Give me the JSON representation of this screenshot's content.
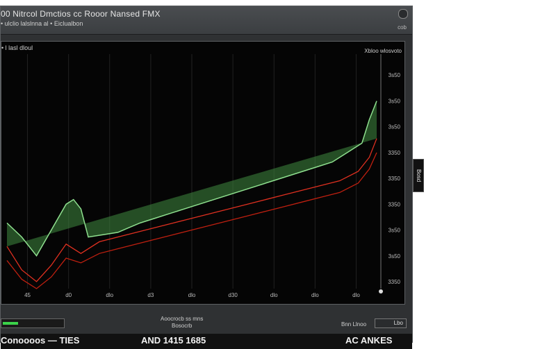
{
  "window": {
    "title": "00 Nitrcol Dmctios cc  Rooor Nansed FMX",
    "subtitle": "• ulclio lalslnna al • Eiclualbon",
    "small_label": "cob"
  },
  "plot": {
    "caption": "• l  lasl dloul",
    "legend": "Xbloo wlosvoto"
  },
  "chart_data": {
    "type": "line",
    "x_ticks": [
      "45",
      "d0",
      "dlo",
      "d3",
      "dlo",
      "d30",
      "dlo",
      "dlo",
      "dlo"
    ],
    "y_ticks": [
      "3s50",
      "3s50",
      "3s50",
      "3350",
      "3350",
      "3350",
      "3s50",
      "3s50",
      "3350"
    ],
    "series": [
      {
        "color": "#8fe08f",
        "x": [
          0,
          4,
          8,
          12,
          16,
          18,
          20,
          22,
          26,
          30,
          33,
          36,
          40,
          44,
          48,
          52,
          56,
          60,
          64,
          68,
          72,
          76,
          80,
          84,
          88,
          92,
          96,
          98,
          100
        ],
        "y": [
          28,
          22,
          14,
          25,
          36,
          38,
          34,
          22,
          23,
          24,
          26,
          28,
          30,
          32,
          34,
          36,
          38,
          40,
          42,
          44,
          46,
          48,
          50,
          52,
          54,
          58,
          62,
          72,
          80
        ]
      },
      {
        "color": "#e03020",
        "x": [
          0,
          4,
          8,
          12,
          16,
          20,
          25,
          30,
          35,
          40,
          45,
          50,
          55,
          60,
          65,
          70,
          75,
          80,
          85,
          90,
          95,
          98,
          100
        ],
        "y": [
          18,
          8,
          3,
          10,
          19,
          15,
          20,
          22,
          24,
          26,
          28,
          30,
          32,
          34,
          36,
          38,
          40,
          42,
          44,
          46,
          50,
          56,
          64
        ]
      },
      {
        "color": "#c02010",
        "x": [
          0,
          4,
          8,
          12,
          16,
          20,
          25,
          30,
          35,
          40,
          45,
          50,
          55,
          60,
          65,
          70,
          75,
          80,
          85,
          90,
          95,
          98,
          100
        ],
        "y": [
          12,
          4,
          0,
          5,
          13,
          11,
          15,
          17,
          19,
          21,
          23,
          25,
          27,
          29,
          31,
          33,
          35,
          37,
          39,
          41,
          45,
          51,
          58
        ]
      }
    ],
    "xlim": [
      0,
      100
    ],
    "ylim": [
      0,
      100
    ],
    "grid": true
  },
  "side_tab": {
    "label": "Bosd"
  },
  "bottom": {
    "status_value": 0.25,
    "mid_line1": "Aoocrocb ss mns",
    "mid_line2": "Bosocrb",
    "right_label": "Bnn Llnoo",
    "right_field": "Lbo"
  },
  "footer": {
    "left": "Conoooos —  TIES",
    "center": "AND  1415  1685",
    "right": "AC ANKES"
  }
}
